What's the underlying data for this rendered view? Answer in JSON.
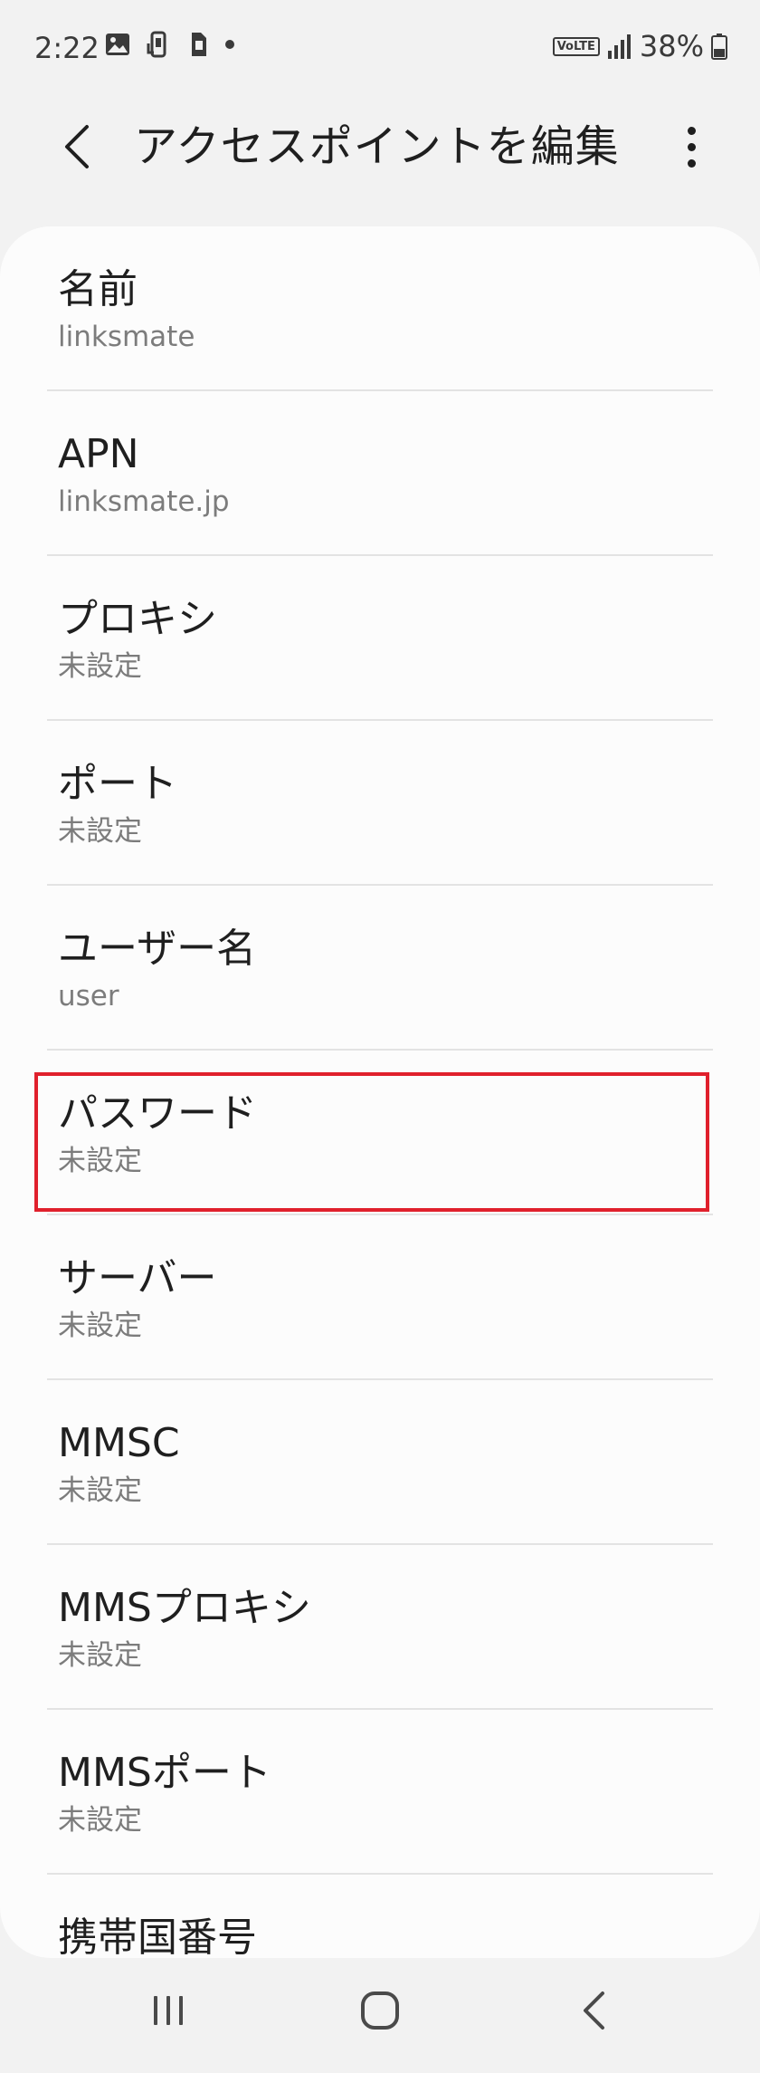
{
  "status_bar": {
    "time": "2:22",
    "volte": "VoLTE",
    "battery": "38%"
  },
  "app_bar": {
    "title": "アクセスポイントを編集",
    "back_icon": "back-arrow-icon",
    "more_icon": "more-vert-icon"
  },
  "apn_settings": [
    {
      "title": "名前",
      "summary": "linksmate"
    },
    {
      "title": "APN",
      "summary": "linksmate.jp"
    },
    {
      "title": "プロキシ",
      "summary": "未設定"
    },
    {
      "title": "ポート",
      "summary": "未設定"
    },
    {
      "title": "ユーザー名",
      "summary": "user"
    },
    {
      "title": "パスワード",
      "summary": "未設定"
    },
    {
      "title": "サーバー",
      "summary": "未設定"
    },
    {
      "title": "MMSC",
      "summary": "未設定"
    },
    {
      "title": "MMSプロキシ",
      "summary": "未設定"
    },
    {
      "title": "MMSポート",
      "summary": "未設定"
    },
    {
      "title": "携帯国番号",
      "summary": ""
    }
  ],
  "highlighted_item": "パスワード",
  "colors": {
    "highlight": "#e0202c",
    "background": "#f2f2f2",
    "card": "#fcfcfc",
    "summary_text": "#7c7c7c"
  },
  "nav_bar": {
    "recents_icon": "recents-icon",
    "home_icon": "home-icon",
    "back_icon": "nav-back-icon"
  }
}
